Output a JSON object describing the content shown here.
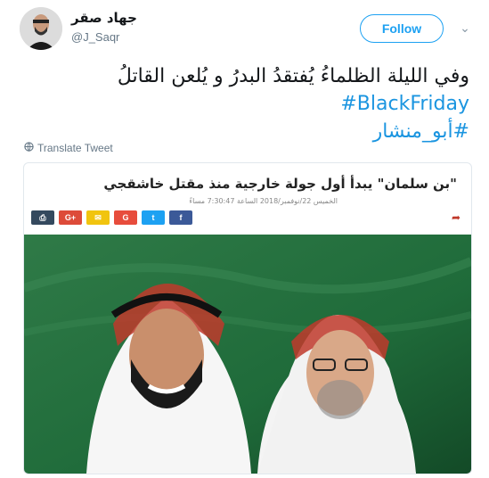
{
  "user": {
    "name": "جهاد صقر",
    "handle": "@J_Saqr"
  },
  "header": {
    "follow_label": "Follow"
  },
  "tweet": {
    "text_line1": "وفي الليلة الظلماءُ يُفتقدُ البدرُ  و يُلعن القاتلُ",
    "hashtag1": "#BlackFriday",
    "hashtag2": "#أبو_منشار"
  },
  "translate_label": "Translate Tweet",
  "card": {
    "title": "\"بن سلمان\" يبدأ أول جولة خارجية منذ مقتل خاشقجي",
    "meta": "الخميس 22/نوفمبر/2018 الساعة 7:30:47 مساءً",
    "share_buttons": [
      {
        "name": "print",
        "glyph": "⎙",
        "color": "#34495e"
      },
      {
        "name": "google-plus",
        "glyph": "G+",
        "color": "#dd4b39"
      },
      {
        "name": "email",
        "glyph": "✉",
        "color": "#f1c40f"
      },
      {
        "name": "google",
        "glyph": "G",
        "color": "#e74c3c"
      },
      {
        "name": "twitter",
        "glyph": "t",
        "color": "#1da1f2"
      },
      {
        "name": "facebook",
        "glyph": "f",
        "color": "#3b5998"
      }
    ]
  },
  "colors": {
    "accent": "#1da1f2",
    "hashtag": "#1b95e0",
    "flag_green": "#1f6b3a"
  }
}
